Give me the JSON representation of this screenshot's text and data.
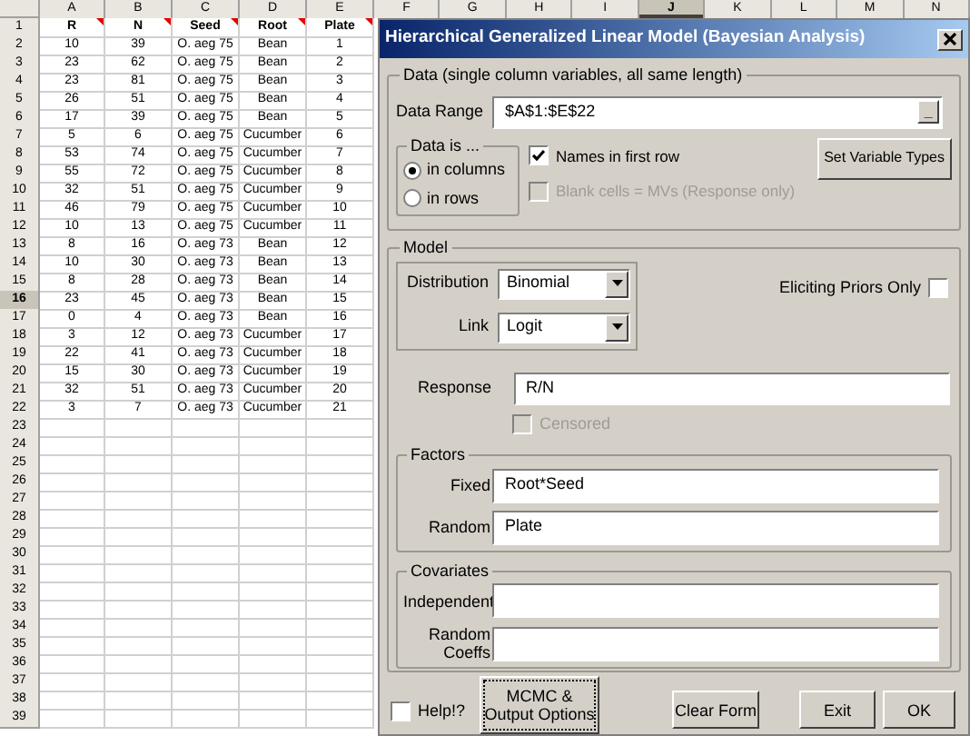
{
  "sheet": {
    "header_row_comments": true,
    "columns": [
      {
        "label": "A",
        "selected": false
      },
      {
        "label": "B",
        "selected": false
      },
      {
        "label": "C",
        "selected": false
      },
      {
        "label": "D",
        "selected": false
      },
      {
        "label": "E",
        "selected": false
      },
      {
        "label": "F",
        "selected": false
      },
      {
        "label": "G",
        "selected": false
      },
      {
        "label": "H",
        "selected": false
      },
      {
        "label": "I",
        "selected": false
      },
      {
        "label": "J",
        "selected": true
      },
      {
        "label": "K",
        "selected": false
      },
      {
        "label": "L",
        "selected": false
      },
      {
        "label": "M",
        "selected": false
      },
      {
        "label": "N",
        "selected": false
      }
    ],
    "rows": [
      {
        "number": "1",
        "selected": false,
        "cells": [
          "R",
          "N",
          "Seed",
          "Root",
          "Plate"
        ]
      },
      {
        "number": "2",
        "selected": false,
        "cells": [
          "10",
          "39",
          "O. aeg 75",
          "Bean",
          "1"
        ]
      },
      {
        "number": "3",
        "selected": false,
        "cells": [
          "23",
          "62",
          "O. aeg 75",
          "Bean",
          "2"
        ]
      },
      {
        "number": "4",
        "selected": false,
        "cells": [
          "23",
          "81",
          "O. aeg 75",
          "Bean",
          "3"
        ]
      },
      {
        "number": "5",
        "selected": false,
        "cells": [
          "26",
          "51",
          "O. aeg 75",
          "Bean",
          "4"
        ]
      },
      {
        "number": "6",
        "selected": false,
        "cells": [
          "17",
          "39",
          "O. aeg 75",
          "Bean",
          "5"
        ]
      },
      {
        "number": "7",
        "selected": false,
        "cells": [
          "5",
          "6",
          "O. aeg 75",
          "Cucumber",
          "6"
        ]
      },
      {
        "number": "8",
        "selected": false,
        "cells": [
          "53",
          "74",
          "O. aeg 75",
          "Cucumber",
          "7"
        ]
      },
      {
        "number": "9",
        "selected": false,
        "cells": [
          "55",
          "72",
          "O. aeg 75",
          "Cucumber",
          "8"
        ]
      },
      {
        "number": "10",
        "selected": false,
        "cells": [
          "32",
          "51",
          "O. aeg 75",
          "Cucumber",
          "9"
        ]
      },
      {
        "number": "11",
        "selected": false,
        "cells": [
          "46",
          "79",
          "O. aeg 75",
          "Cucumber",
          "10"
        ]
      },
      {
        "number": "12",
        "selected": false,
        "cells": [
          "10",
          "13",
          "O. aeg 75",
          "Cucumber",
          "11"
        ]
      },
      {
        "number": "13",
        "selected": false,
        "cells": [
          "8",
          "16",
          "O. aeg 73",
          "Bean",
          "12"
        ]
      },
      {
        "number": "14",
        "selected": false,
        "cells": [
          "10",
          "30",
          "O. aeg 73",
          "Bean",
          "13"
        ]
      },
      {
        "number": "15",
        "selected": false,
        "cells": [
          "8",
          "28",
          "O. aeg 73",
          "Bean",
          "14"
        ]
      },
      {
        "number": "16",
        "selected": true,
        "cells": [
          "23",
          "45",
          "O. aeg 73",
          "Bean",
          "15"
        ]
      },
      {
        "number": "17",
        "selected": false,
        "cells": [
          "0",
          "4",
          "O. aeg 73",
          "Bean",
          "16"
        ]
      },
      {
        "number": "18",
        "selected": false,
        "cells": [
          "3",
          "12",
          "O. aeg 73",
          "Cucumber",
          "17"
        ]
      },
      {
        "number": "19",
        "selected": false,
        "cells": [
          "22",
          "41",
          "O. aeg 73",
          "Cucumber",
          "18"
        ]
      },
      {
        "number": "20",
        "selected": false,
        "cells": [
          "15",
          "30",
          "O. aeg 73",
          "Cucumber",
          "19"
        ]
      },
      {
        "number": "21",
        "selected": false,
        "cells": [
          "32",
          "51",
          "O. aeg 73",
          "Cucumber",
          "20"
        ]
      },
      {
        "number": "22",
        "selected": false,
        "cells": [
          "3",
          "7",
          "O. aeg 73",
          "Cucumber",
          "21"
        ]
      },
      {
        "number": "23",
        "selected": false
      },
      {
        "number": "24",
        "selected": false
      },
      {
        "number": "25",
        "selected": false
      },
      {
        "number": "26",
        "selected": false
      },
      {
        "number": "27",
        "selected": false
      },
      {
        "number": "28",
        "selected": false
      },
      {
        "number": "29",
        "selected": false
      },
      {
        "number": "30",
        "selected": false
      },
      {
        "number": "31",
        "selected": false
      },
      {
        "number": "32",
        "selected": false
      },
      {
        "number": "33",
        "selected": false
      },
      {
        "number": "34",
        "selected": false
      },
      {
        "number": "35",
        "selected": false
      },
      {
        "number": "36",
        "selected": false
      },
      {
        "number": "37",
        "selected": false
      },
      {
        "number": "38",
        "selected": false
      },
      {
        "number": "39",
        "selected": false
      }
    ]
  },
  "dialog": {
    "title": "Hierarchical Generalized Linear Model (Bayesian Analysis)",
    "data_group": {
      "legend": "Data (single column variables, all same length)",
      "range_label": "Data Range",
      "range_value": "$A$1:$E$22",
      "range_button": "_",
      "orientation_legend": "Data is ...",
      "orientation_options": [
        {
          "label": "in columns",
          "selected": true
        },
        {
          "label": "in rows",
          "selected": false
        }
      ],
      "checkboxes": [
        {
          "label": "Names in first row",
          "checked": true,
          "disabled": false
        },
        {
          "label": "Blank cells = MVs (Response only)",
          "checked": false,
          "disabled": true
        }
      ],
      "button": "Set Variable Types"
    },
    "model_group": {
      "legend": "Model",
      "selects": [
        {
          "label": "Distribution",
          "value": "Binomial"
        },
        {
          "label": "Link",
          "value": "Logit"
        }
      ],
      "eliciting": {
        "label": "Eliciting Priors Only",
        "checked": false,
        "disabled": false
      },
      "response_label": "Response",
      "response_value": "R/N",
      "censored": {
        "label": "Censored",
        "checked": false,
        "disabled": true
      },
      "factors": {
        "legend": "Factors",
        "fields": [
          {
            "label": "Fixed",
            "value": "Root*Seed"
          },
          {
            "label": "Random",
            "value": "Plate"
          }
        ]
      },
      "covariates": {
        "legend": "Covariates",
        "fields": [
          {
            "label": "Independent"
          },
          {
            "label": "Random Coeffs"
          }
        ]
      }
    },
    "footer": {
      "help": {
        "label": "Help!?",
        "checked": false,
        "disabled": false
      },
      "buttons": [
        {
          "label": "MCMC & Output Options",
          "focused": true
        },
        {
          "label": "Clear Form",
          "focused": false
        },
        {
          "label": "Exit",
          "focused": false
        },
        {
          "label": "OK",
          "focused": false
        }
      ]
    }
  }
}
